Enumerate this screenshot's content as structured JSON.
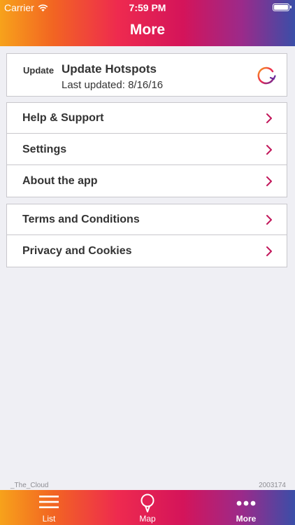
{
  "status_bar": {
    "carrier": "Carrier",
    "time": "7:59 PM"
  },
  "header": {
    "title": "More"
  },
  "update": {
    "tag": "Update",
    "title": "Update Hotspots",
    "last_updated": "Last updated: 8/16/16"
  },
  "menu_group_1": [
    {
      "label": "Help & Support"
    },
    {
      "label": "Settings"
    },
    {
      "label": "About the app"
    }
  ],
  "menu_group_2": [
    {
      "label": "Terms and Conditions"
    },
    {
      "label": "Privacy and Cookies"
    }
  ],
  "footer": {
    "left": "_The_Cloud",
    "right": "2003174"
  },
  "tabs": [
    {
      "label": "List",
      "icon": "list-icon"
    },
    {
      "label": "Map",
      "icon": "map-pin-icon"
    },
    {
      "label": "More",
      "icon": "more-dots-icon"
    }
  ],
  "colors": {
    "accent": "#d4145a",
    "gradient_start": "#f7a21b",
    "gradient_end": "#3a4ea8"
  }
}
